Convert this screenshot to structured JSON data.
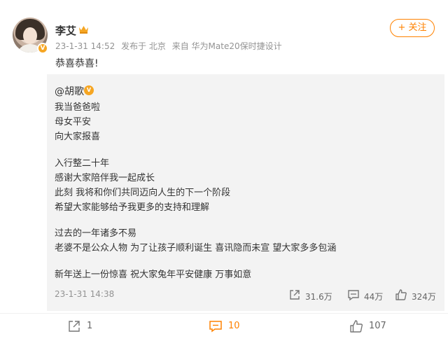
{
  "post": {
    "username": "李艾",
    "date": "23-1-31 14:52",
    "location": "发布于 北京",
    "source": "来自 华为Mate20保时捷设计",
    "text": "恭喜恭喜!",
    "follow_label": "+ 关注"
  },
  "repost": {
    "author": "@胡歌",
    "lines": [
      "我当爸爸啦",
      "母女平安",
      "向大家报喜",
      "入行整二十年",
      "感谢大家陪伴我一起成长",
      "此刻 我将和你们共同迈向人生的下一个阶段",
      "希望大家能够给予我更多的支持和理解",
      "过去的一年诸多不易",
      "老婆不是公众人物 为了让孩子顺利诞生 喜讯隐而未宣 望大家多多包涵",
      "新年送上一份惊喜 祝大家兔年平安健康 万事如意"
    ],
    "time": "23-1-31 14:38",
    "reposts": "31.6万",
    "comments": "44万",
    "likes": "324万"
  },
  "actions": {
    "reposts": "1",
    "comments": "10",
    "likes": "107"
  },
  "colors": {
    "accent": "#ff8200",
    "badge": "#f6a623",
    "muted": "#939393",
    "repost_bg": "#f3f3f3"
  }
}
